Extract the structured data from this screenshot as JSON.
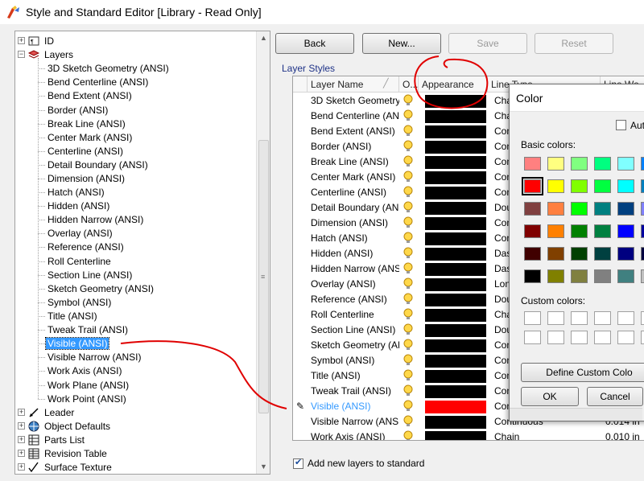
{
  "window": {
    "title": "Style and Standard Editor [Library - Read Only]"
  },
  "tree": {
    "top_nodes": [
      {
        "label": "ID",
        "icon": "id-icon",
        "expander": "+"
      },
      {
        "label": "Layers",
        "icon": "layers-icon",
        "expander": "−"
      }
    ],
    "layer_children": [
      "3D Sketch Geometry (ANSI)",
      "Bend Centerline (ANSI)",
      "Bend Extent (ANSI)",
      "Border (ANSI)",
      "Break Line (ANSI)",
      "Center Mark (ANSI)",
      "Centerline (ANSI)",
      "Detail Boundary (ANSI)",
      "Dimension (ANSI)",
      "Hatch (ANSI)",
      "Hidden (ANSI)",
      "Hidden Narrow (ANSI)",
      "Overlay (ANSI)",
      "Reference (ANSI)",
      "Roll Centerline",
      "Section Line (ANSI)",
      "Sketch Geometry (ANSI)",
      "Symbol (ANSI)",
      "Title (ANSI)",
      "Tweak Trail (ANSI)",
      "Visible (ANSI)",
      "Visible Narrow (ANSI)",
      "Work Axis (ANSI)",
      "Work Plane (ANSI)",
      "Work Point (ANSI)"
    ],
    "selected_child": "Visible (ANSI)",
    "bottom_nodes": [
      {
        "label": "Leader",
        "icon": "leader-icon",
        "expander": "+"
      },
      {
        "label": "Object Defaults",
        "icon": "object-defaults-icon",
        "expander": "+"
      },
      {
        "label": "Parts List",
        "icon": "parts-list-icon",
        "expander": "+"
      },
      {
        "label": "Revision Table",
        "icon": "revision-table-icon",
        "expander": "+"
      },
      {
        "label": "Surface Texture",
        "icon": "surface-texture-icon",
        "expander": "+"
      }
    ]
  },
  "toolbar": {
    "back": "Back",
    "new": "New...",
    "save": "Save",
    "reset": "Reset"
  },
  "layer_styles": {
    "group_label": "Layer Styles",
    "columns": {
      "name": "Layer Name",
      "on": "O...",
      "appearance": "Appearance",
      "line_type": "Line Type",
      "line_weight": "Line We..."
    },
    "rows": [
      {
        "name": "3D Sketch Geometry",
        "color": "#000000",
        "line_type": "Chain",
        "line_weight": ""
      },
      {
        "name": "Bend Centerline (ANSI)",
        "color": "#000000",
        "line_type": "Chain",
        "line_weight": ""
      },
      {
        "name": "Bend Extent (ANSI)",
        "color": "#000000",
        "line_type": "Continuous",
        "line_weight": ""
      },
      {
        "name": "Border (ANSI)",
        "color": "#000000",
        "line_type": "Continuous",
        "line_weight": ""
      },
      {
        "name": "Break Line (ANSI)",
        "color": "#000000",
        "line_type": "Continuous",
        "line_weight": ""
      },
      {
        "name": "Center Mark (ANSI)",
        "color": "#000000",
        "line_type": "Continuous",
        "line_weight": ""
      },
      {
        "name": "Centerline (ANSI)",
        "color": "#000000",
        "line_type": "Continuous",
        "line_weight": ""
      },
      {
        "name": "Detail Boundary (ANSI)",
        "color": "#000000",
        "line_type": "Double",
        "line_weight": ""
      },
      {
        "name": "Dimension (ANSI)",
        "color": "#000000",
        "line_type": "Continuous",
        "line_weight": ""
      },
      {
        "name": "Hatch (ANSI)",
        "color": "#000000",
        "line_type": "Continuous",
        "line_weight": ""
      },
      {
        "name": "Hidden (ANSI)",
        "color": "#000000",
        "line_type": "Dashed",
        "line_weight": ""
      },
      {
        "name": "Hidden Narrow (ANSI)",
        "color": "#000000",
        "line_type": "Dashed",
        "line_weight": ""
      },
      {
        "name": "Overlay (ANSI)",
        "color": "#000000",
        "line_type": "Long",
        "line_weight": ""
      },
      {
        "name": "Reference (ANSI)",
        "color": "#000000",
        "line_type": "Double",
        "line_weight": ""
      },
      {
        "name": "Roll Centerline",
        "color": "#000000",
        "line_type": "Chain",
        "line_weight": ""
      },
      {
        "name": "Section Line (ANSI)",
        "color": "#000000",
        "line_type": "Double",
        "line_weight": ""
      },
      {
        "name": "Sketch Geometry (ANSI)",
        "color": "#000000",
        "line_type": "Continuous",
        "line_weight": ""
      },
      {
        "name": "Symbol (ANSI)",
        "color": "#000000",
        "line_type": "Continuous",
        "line_weight": ""
      },
      {
        "name": "Title (ANSI)",
        "color": "#000000",
        "line_type": "Continuous",
        "line_weight": ""
      },
      {
        "name": "Tweak Trail (ANSI)",
        "color": "#000000",
        "line_type": "Continuous",
        "line_weight": ""
      },
      {
        "name": "Visible (ANSI)",
        "color": "#ff0000",
        "line_type": "Continuous",
        "line_weight": "",
        "editing": true
      },
      {
        "name": "Visible Narrow (ANSI)",
        "color": "#000000",
        "line_type": "Continuous",
        "line_weight": "0.014 in"
      },
      {
        "name": "Work Axis (ANSI)",
        "color": "#000000",
        "line_type": "Chain",
        "line_weight": "0.010 in"
      }
    ],
    "add_layers_checkbox": {
      "label": "Add new layers to standard",
      "checked": true
    }
  },
  "color_dialog": {
    "title": "Color",
    "auto_label": "Aut",
    "basic_label": "Basic colors:",
    "custom_label": "Custom colors:",
    "basic_colors": [
      [
        "#ff8080",
        "#ffff80",
        "#80ff80",
        "#00ff80",
        "#80ffff",
        "#0080ff"
      ],
      [
        "#ff0000",
        "#ffff00",
        "#80ff00",
        "#00ff40",
        "#00ffff",
        "#0080c0"
      ],
      [
        "#804040",
        "#ff8040",
        "#00ff00",
        "#008080",
        "#004080",
        "#8080ff"
      ],
      [
        "#800000",
        "#ff8000",
        "#008000",
        "#008040",
        "#0000ff",
        "#0000a0"
      ],
      [
        "#400000",
        "#804000",
        "#004000",
        "#004040",
        "#000080",
        "#000040"
      ],
      [
        "#000000",
        "#808000",
        "#808040",
        "#808080",
        "#408080",
        "#c0c0c0"
      ]
    ],
    "selected_basic": "#ff0000",
    "define_custom": "Define Custom Colo",
    "ok": "OK",
    "cancel": "Cancel"
  },
  "annotation_color": "#e00000"
}
